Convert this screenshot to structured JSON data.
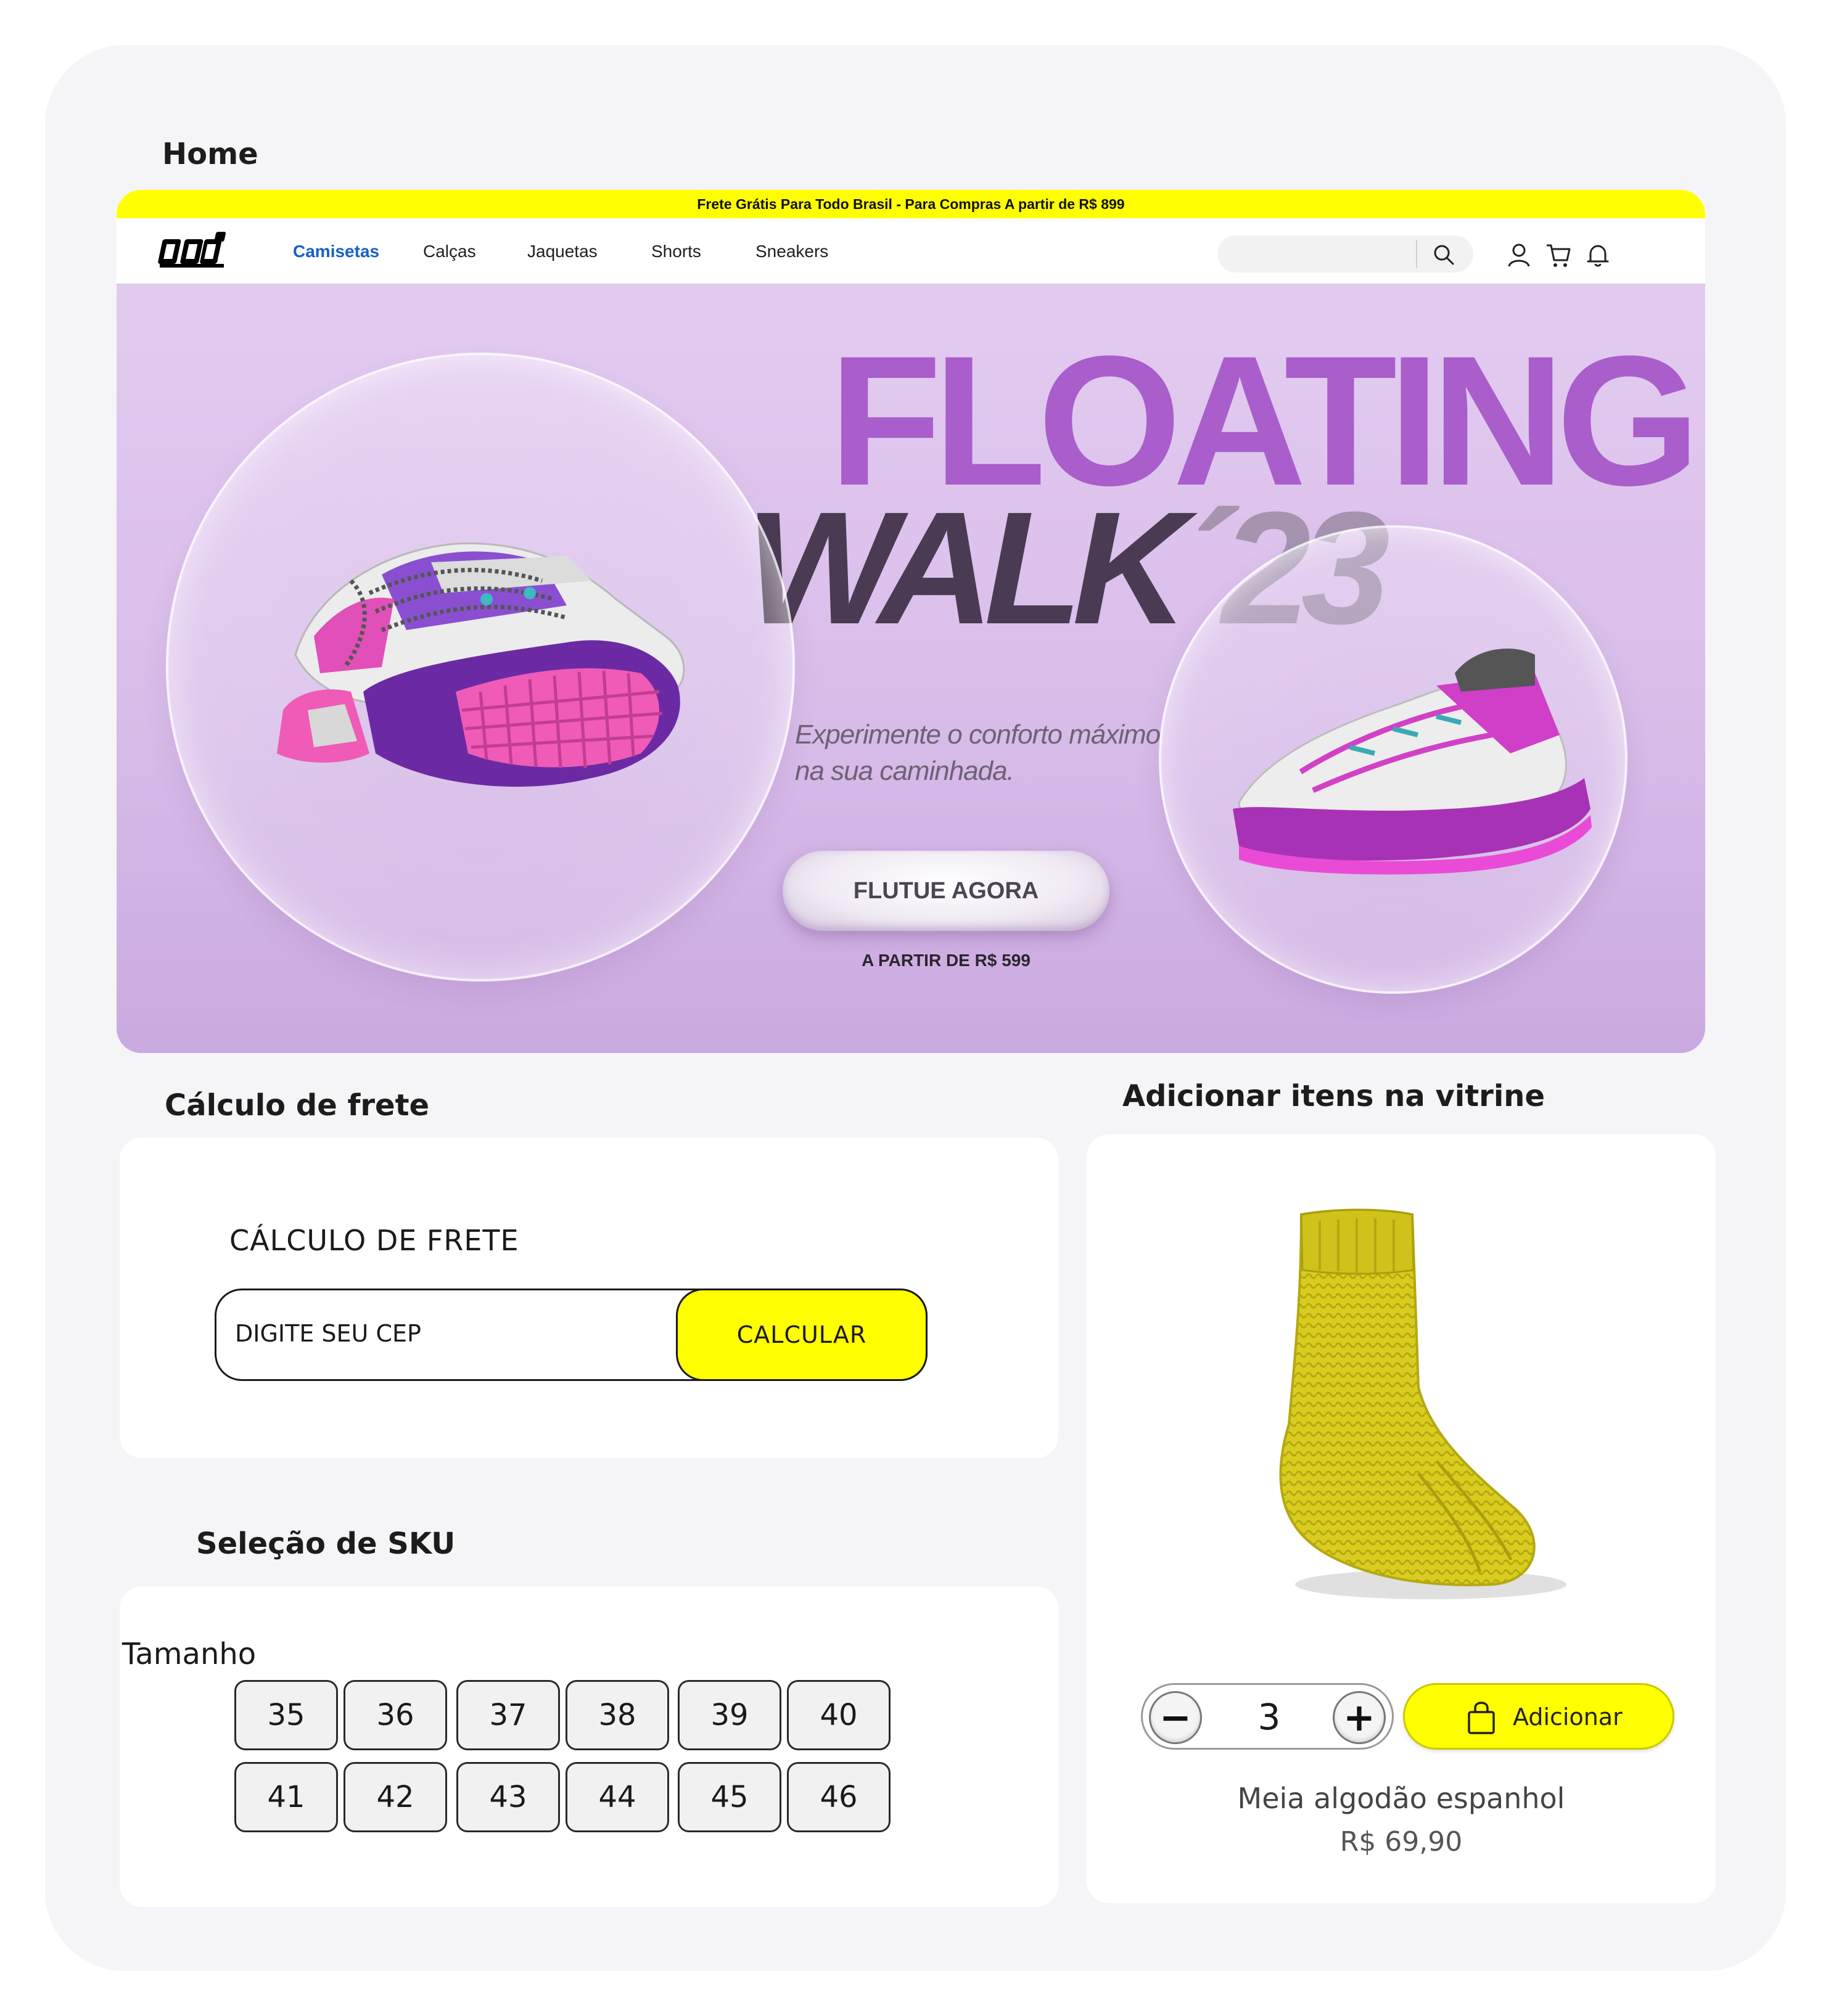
{
  "sections": {
    "home": "Home",
    "frete": "Cálculo de frete",
    "vitrine": "Adicionar itens na vitrine",
    "sku": "Seleção de SKU"
  },
  "promo_bar": "Frete Grátis Para Todo Brasil - Para Compras A partir de R$ 899",
  "nav": {
    "links": [
      "Camisetas",
      "Calças",
      "Jaquetas",
      "Shorts",
      "Sneakers"
    ],
    "active": "Camisetas",
    "search_placeholder": "",
    "icons": [
      "search-icon",
      "user-icon",
      "cart-icon",
      "bell-icon"
    ]
  },
  "hero": {
    "title_line1": "FLOATING",
    "title_line2_main": "WALK",
    "title_line2_year": "´23",
    "subtitle": "Experimente o conforto máximo na sua caminhada.",
    "cta": "FLUTUE AGORA",
    "price": "A PARTIR DE R$ 599"
  },
  "frete": {
    "label": "CÁLCULO DE FRETE",
    "input_placeholder": "DIGITE SEU CEP",
    "button": "CALCULAR"
  },
  "sku": {
    "label": "Tamanho",
    "sizes": [
      "35",
      "36",
      "37",
      "38",
      "39",
      "40",
      "41",
      "42",
      "43",
      "44",
      "45",
      "46"
    ]
  },
  "vitrine": {
    "quantity": "3",
    "minus": "−",
    "plus": "+",
    "add_button": "Adicionar",
    "product_name": "Meia algodão espanhol",
    "product_price": "R$ 69,90"
  },
  "colors": {
    "accent_yellow": "#ffff00",
    "active_link": "#1560c9",
    "hero_bg": "#dcc3ec",
    "hero_title": "#a95ecb",
    "hero_title_dark": "#4a3a52"
  }
}
